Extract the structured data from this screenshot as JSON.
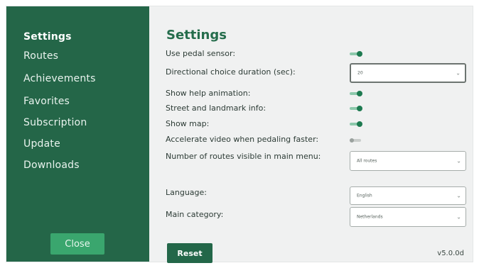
{
  "sidebar": {
    "items": [
      {
        "label": "Settings",
        "active": true
      },
      {
        "label": "Routes"
      },
      {
        "label": "Achievements"
      },
      {
        "label": "Favorites"
      },
      {
        "label": "Subscription"
      },
      {
        "label": "Update"
      },
      {
        "label": "Downloads"
      }
    ],
    "close_label": "Close"
  },
  "main": {
    "title": "Settings",
    "rows": {
      "pedal_sensor": {
        "label": "Use pedal sensor:",
        "on": true
      },
      "choice_duration": {
        "label": "Directional choice duration (sec):",
        "value": "20"
      },
      "help_animation": {
        "label": "Show help animation:",
        "on": true
      },
      "street_info": {
        "label": "Street and landmark info:",
        "on": true
      },
      "show_map": {
        "label": "Show map:",
        "on": true
      },
      "accelerate_video": {
        "label": "Accelerate video when pedaling faster:",
        "on": false
      },
      "routes_visible": {
        "label": "Number of routes visible in main menu:",
        "value": "All routes"
      },
      "language": {
        "label": "Language:",
        "value": "English"
      },
      "main_category": {
        "label": "Main category:",
        "value": "Netherlands"
      }
    },
    "reset_label": "Reset",
    "version": "v5.0.0d"
  },
  "colors": {
    "sidebar_bg": "#246648",
    "accent": "#1d7a50",
    "close_button": "#3aa66e",
    "title": "#256d4c"
  },
  "icons": [
    "chevron-down-icon",
    "toggle-switch"
  ]
}
